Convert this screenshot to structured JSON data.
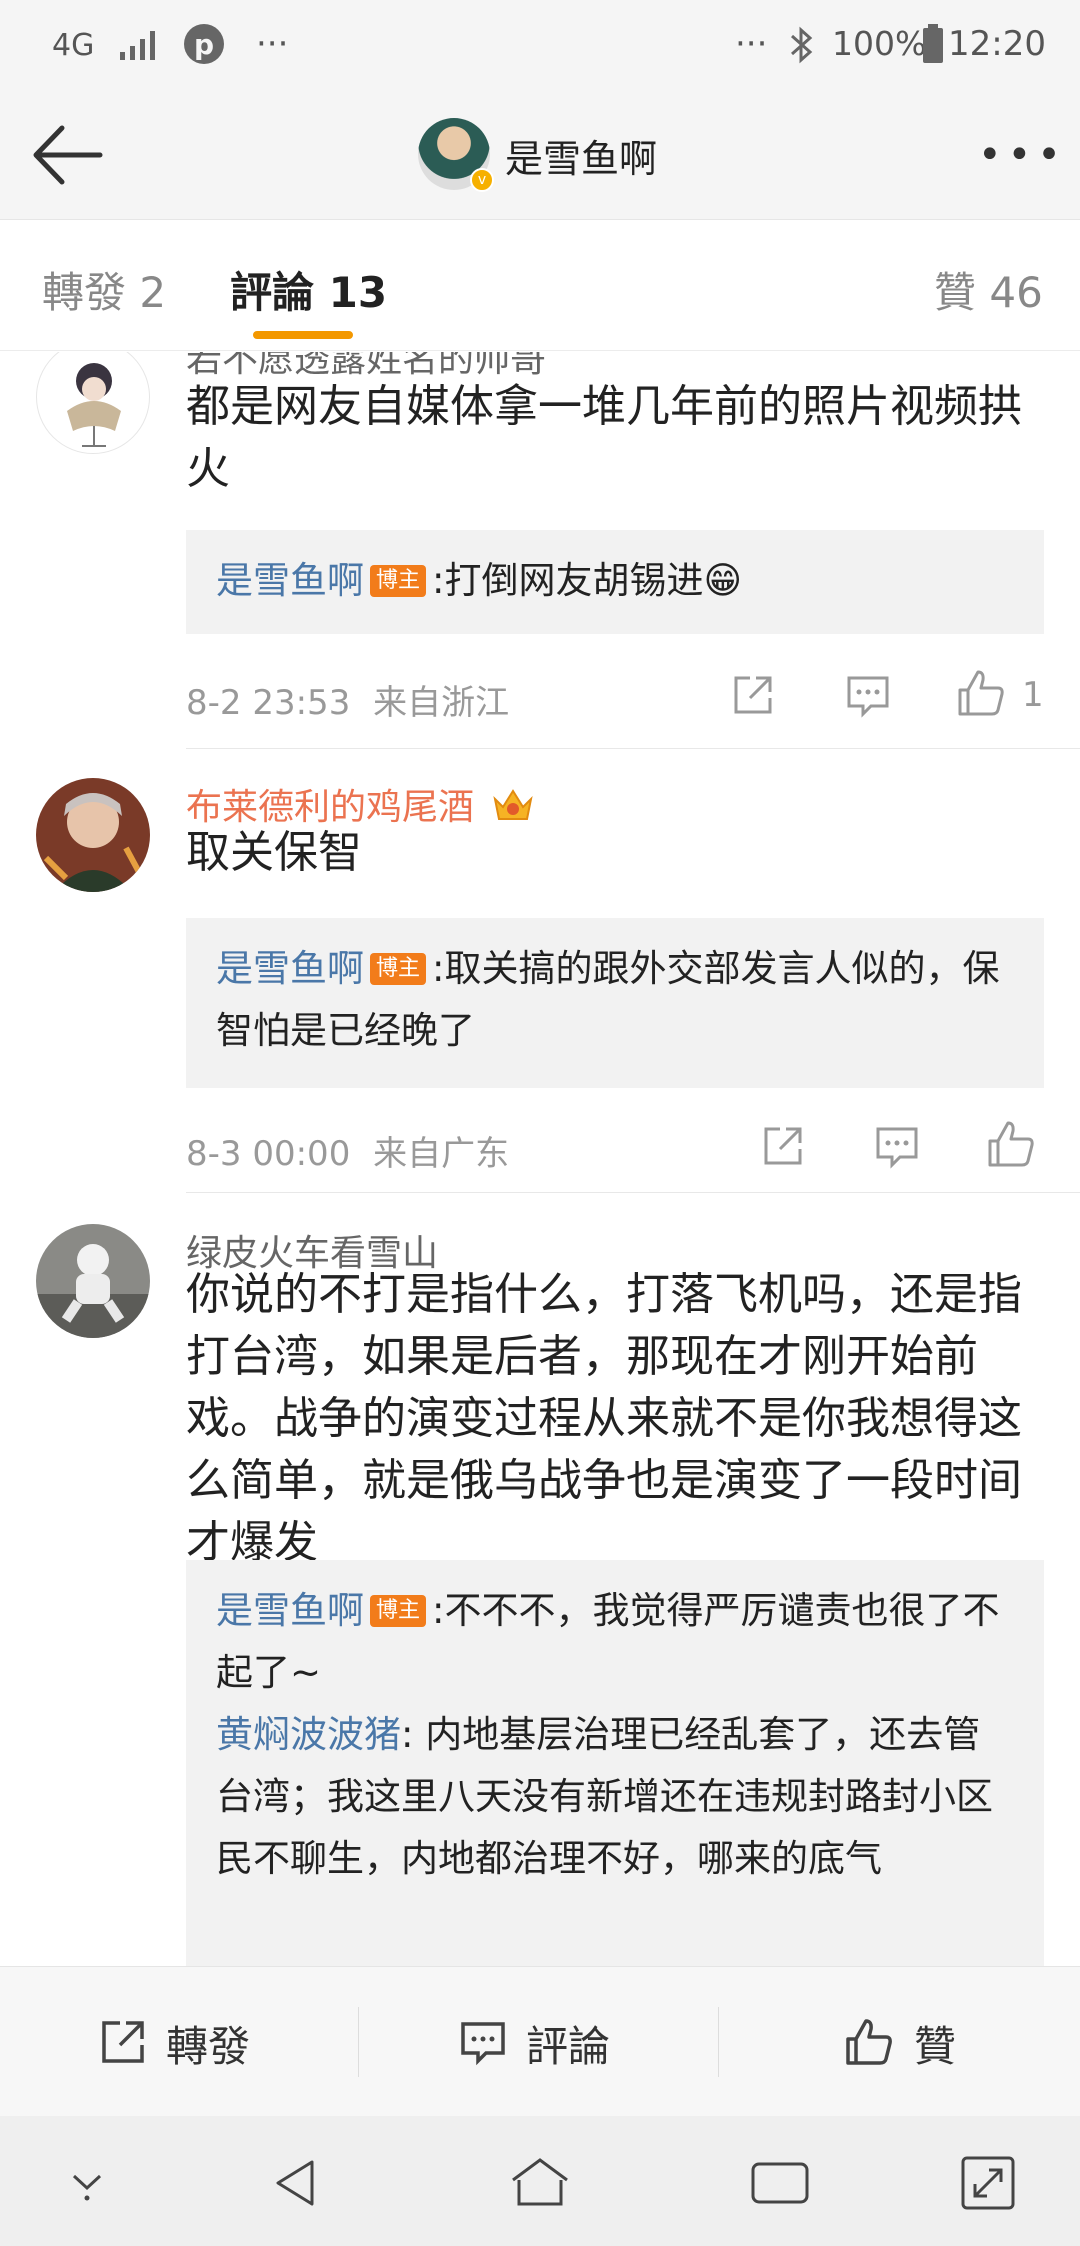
{
  "status": {
    "network": "4G",
    "more_left": "···",
    "more_right": "···",
    "battery": "100%",
    "time": "12:20"
  },
  "header": {
    "title": "是雪鱼啊"
  },
  "tabs": [
    {
      "label": "轉發 2"
    },
    {
      "label": "評論 13"
    },
    {
      "label": "贊 46"
    }
  ],
  "comments": [
    {
      "name": "若不愿透露姓名的帅哥",
      "text": "都是网友自媒体拿一堆几年前的照片视频拱火",
      "replies": [
        {
          "name": "是雪鱼啊",
          "badge": "博主",
          "text": ":打倒网友胡锡进😁"
        }
      ],
      "time": "8-2 23:53",
      "source": "来自浙江",
      "likes": "1"
    },
    {
      "name": "布莱德利的鸡尾酒",
      "text": "取关保智",
      "replies": [
        {
          "name": "是雪鱼啊",
          "badge": "博主",
          "text": ":取关搞的跟外交部发言人似的，保智怕是已经晚了"
        }
      ],
      "time": "8-3 00:00",
      "source": "来自广东",
      "likes": ""
    },
    {
      "name": "绿皮火车看雪山",
      "text": "你说的不打是指什么，打落飞机吗，还是指打台湾，如果是后者，那现在才刚开始前戏。战争的演变过程从来就不是你我想得这么简单，就是俄乌战争也是演变了一段时间才爆发",
      "replies": [
        {
          "name": "是雪鱼啊",
          "badge": "博主",
          "text": ":不不不，我觉得严厉谴责也很了不起了~"
        },
        {
          "name": "黄焖波波猪",
          "badge": "",
          "text": ": 内地基层治理已经乱套了，还去管台湾；我这里八天没有新增还在违规封路封小区民不聊生，内地都治理不好，哪来的底气"
        }
      ]
    }
  ],
  "bottom": {
    "repost": "轉發",
    "comment": "評論",
    "like": "贊"
  },
  "colors": {
    "accent": "#f39800",
    "username_orange": "#eb7350",
    "reply_name_blue": "#4a77a8",
    "badge_orange": "#f27c1a"
  }
}
